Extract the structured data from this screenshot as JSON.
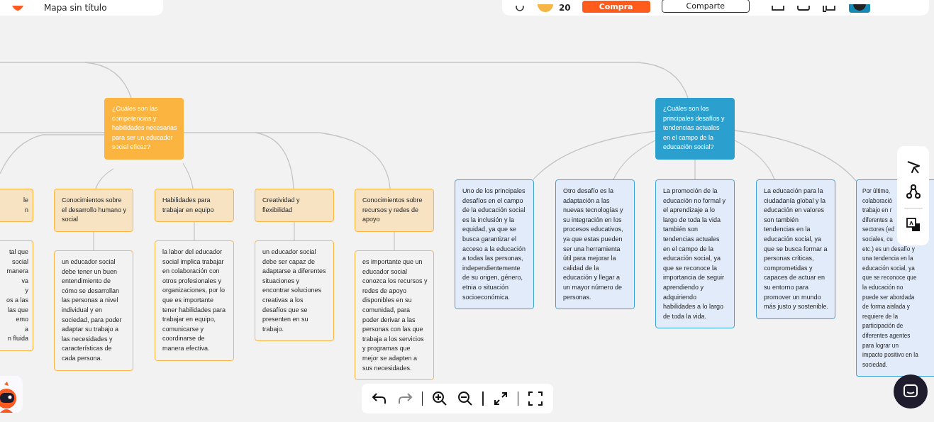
{
  "top_bar": {
    "title": "Mapa sin título",
    "credits": "20",
    "buy_button": "Compra",
    "share_button": "Comparte"
  },
  "topics": [
    {
      "kind": "orange",
      "title": "¿Cuáles son las competencias y habilidades necesarias para ser un educador social eficaz?",
      "branches": [
        {
          "kind": "partial",
          "heading_lines": [
            "le",
            "n"
          ],
          "detail_lines": [
            "tal que",
            "social",
            "manera",
            "va",
            "y",
            "os a las",
            "las que",
            "emo",
            "a",
            "n fluida"
          ]
        },
        {
          "kind": "full",
          "heading": "Conocimientos sobre el desarrollo humano y social",
          "detail": "un educador social debe tener un buen entendimiento de cómo se desarrollan las personas a nivel individual y en sociedad, para poder adaptar su trabajo a las necesidades y características de cada persona."
        },
        {
          "kind": "full",
          "heading": "Habilidades para trabajar en equipo",
          "detail": "la labor del educador social implica trabajar en colaboración con otros profesionales y organizaciones, por lo que es importante tener habilidades para trabajar en equipo, comunicarse y coordinarse de manera efectiva."
        },
        {
          "kind": "full",
          "heading": "Creatividad y flexibilidad",
          "detail": "un educador social debe ser capaz de adaptarse a diferentes situaciones y encontrar soluciones creativas a los desafíos que se presenten en su trabajo."
        },
        {
          "kind": "full",
          "heading": "Conocimientos sobre recursos y redes de apoyo",
          "detail": "es importante que un educador social conozca los recursos y redes de apoyo disponibles en su comunidad, para poder derivar a las personas con las que trabaja a los servicios y programas que mejor se adapten a sus necesidades."
        }
      ]
    },
    {
      "kind": "blue",
      "title": "¿Cuáles son los principales desafíos y tendencias actuales en el campo de la educación social?",
      "branches": [
        {
          "kind": "full",
          "detail": "Uno de los principales desafíos en el campo de la educación social es la inclusión y la equidad, ya que se busca garantizar el acceso a la educación a todas las personas, independientemente de su origen, género, etnia o situación socioeconómica."
        },
        {
          "kind": "full",
          "detail": "Otro desafío es la adaptación a las nuevas tecnologías y su integración en los procesos educativos, ya que estas pueden ser una herramienta útil para mejorar la calidad de la educación y llegar a un mayor número de personas."
        },
        {
          "kind": "full",
          "detail": "La promoción de la educación no formal y el aprendizaje a lo largo de toda la vida también son tendencias actuales en el campo de la educación social, ya que se reconoce la importancia de seguir aprendiendo y adquiriendo habilidades a lo largo de toda la vida."
        },
        {
          "kind": "full",
          "detail": "La educación para la ciudadanía global y la educación en valores son también tendencias en la educación social, ya que se busca formar a personas críticas, comprometidas y capaces de actuar en su entorno para promover un mundo más justo y sostenible."
        },
        {
          "kind": "partial",
          "detail_lines": [
            "Por último,",
            "colaboració",
            "trabajo en r",
            "diferentes a",
            "sectores (ed",
            "sociales, cu",
            "etc.) es un desafío y",
            "una tendencia en la",
            "educación social, ya",
            "que se reconoce que",
            "la educación no",
            "puede ser abordada",
            "de forma aislada y",
            "requiere de la",
            "participación de",
            "diferentes agentes",
            "para lograr un",
            "impacto positivo en la",
            "sociedad."
          ]
        }
      ]
    }
  ],
  "zoom_toolbar": {
    "redo_disabled": true
  }
}
